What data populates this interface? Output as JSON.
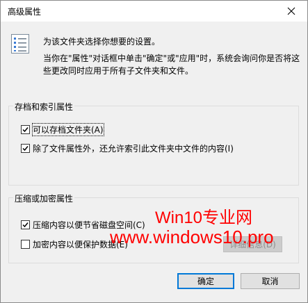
{
  "window": {
    "title": "高级属性"
  },
  "description": {
    "line1": "为该文件夹选择你想要的设置。",
    "line2": "当你在\"属性\"对话框中单击\"确定\"或\"应用\"时，系统会询问你是否将这些更改同时应用于所有子文件夹和文件。"
  },
  "archive_group": {
    "legend": "存档和索引属性",
    "options": [
      {
        "label": "可以存档文件夹(A)",
        "checked": true
      },
      {
        "label": "除了文件属性外，还允许索引此文件夹中文件的内容(I)",
        "checked": true
      }
    ]
  },
  "compress_group": {
    "legend": "压缩或加密属性",
    "options": [
      {
        "label": "压缩内容以便节省磁盘空间(C)",
        "checked": true
      },
      {
        "label": "加密内容以便保护数据(E)",
        "checked": false
      }
    ],
    "details_label": "详细信息(D)"
  },
  "buttons": {
    "ok": "确定",
    "cancel": "取消"
  },
  "watermark": {
    "line1": "Win10专业网",
    "line2": "www.windows10.pro"
  },
  "colors": {
    "accent": "#0078d7",
    "watermark": "#ff0000"
  }
}
